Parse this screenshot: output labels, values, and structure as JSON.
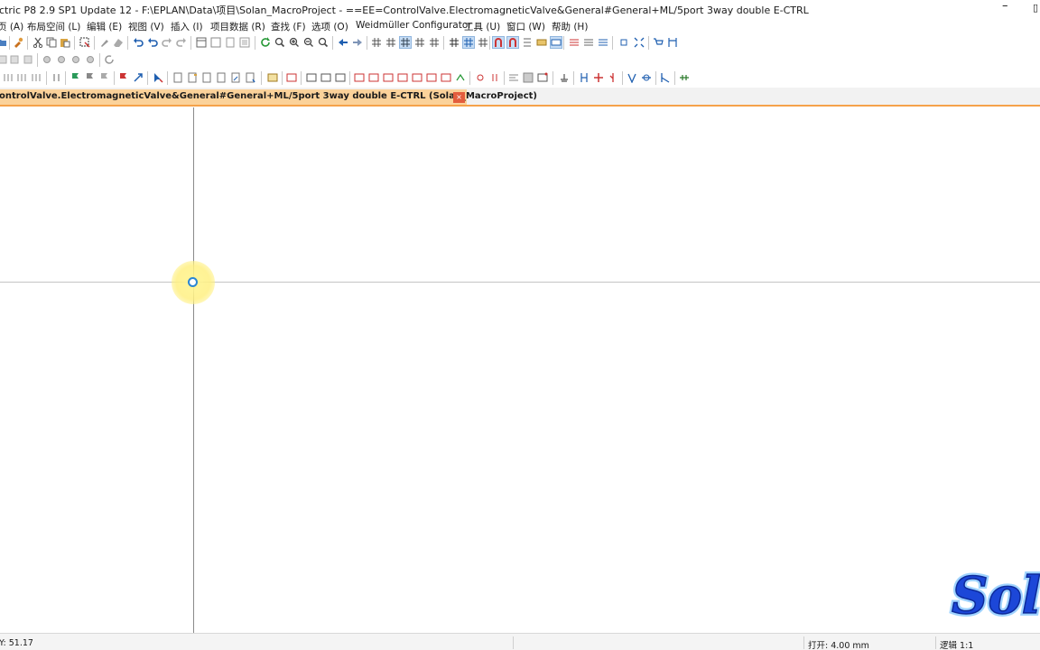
{
  "window": {
    "title": "ctric P8 2.9 SP1 Update 12 - F:\\EPLAN\\Data\\项目\\Solan_MacroProject - ==EE=ControlValve.ElectromagneticValve&General#General+ML/5port 3way double E-CTRL",
    "minimize_glyph": "–",
    "maximize_glyph": "▯"
  },
  "menu": [
    {
      "id": "page",
      "label": "页 (A)"
    },
    {
      "id": "layout",
      "label": "布局空间 (L)"
    },
    {
      "id": "edit",
      "label": "编辑 (E)"
    },
    {
      "id": "view",
      "label": "视图 (V)"
    },
    {
      "id": "insert",
      "label": "插入 (I)"
    },
    {
      "id": "projectdata",
      "label": "项目数据 (R)"
    },
    {
      "id": "find",
      "label": "查找 (F)"
    },
    {
      "id": "options",
      "label": "选项 (O)"
    },
    {
      "id": "weidmuller",
      "label": "Weidmüller Configurator"
    },
    {
      "id": "tools",
      "label": "工具 (U)"
    },
    {
      "id": "window",
      "label": "窗口 (W)"
    },
    {
      "id": "help",
      "label": "帮助 (H)"
    }
  ],
  "tab": {
    "label": "ontrolValve.ElectromagneticValve&General#General+ML/5port 3way double E-CTRL (Solan_MacroProject)",
    "close_glyph": "×"
  },
  "status": {
    "coords": "Y: 51.17",
    "snap": "打开: 4.00 mm",
    "logic": "逻辑 1:1"
  },
  "colors": {
    "tab_active": "#fbd29a",
    "tab_border": "#f5a24a",
    "tab_close": "#e35d3d",
    "cursor_ring": "#2a86d4",
    "cursor_glow": "#fff59a",
    "watermark_fill": "#1c47d8",
    "watermark_outline": "#9fd3ff"
  }
}
